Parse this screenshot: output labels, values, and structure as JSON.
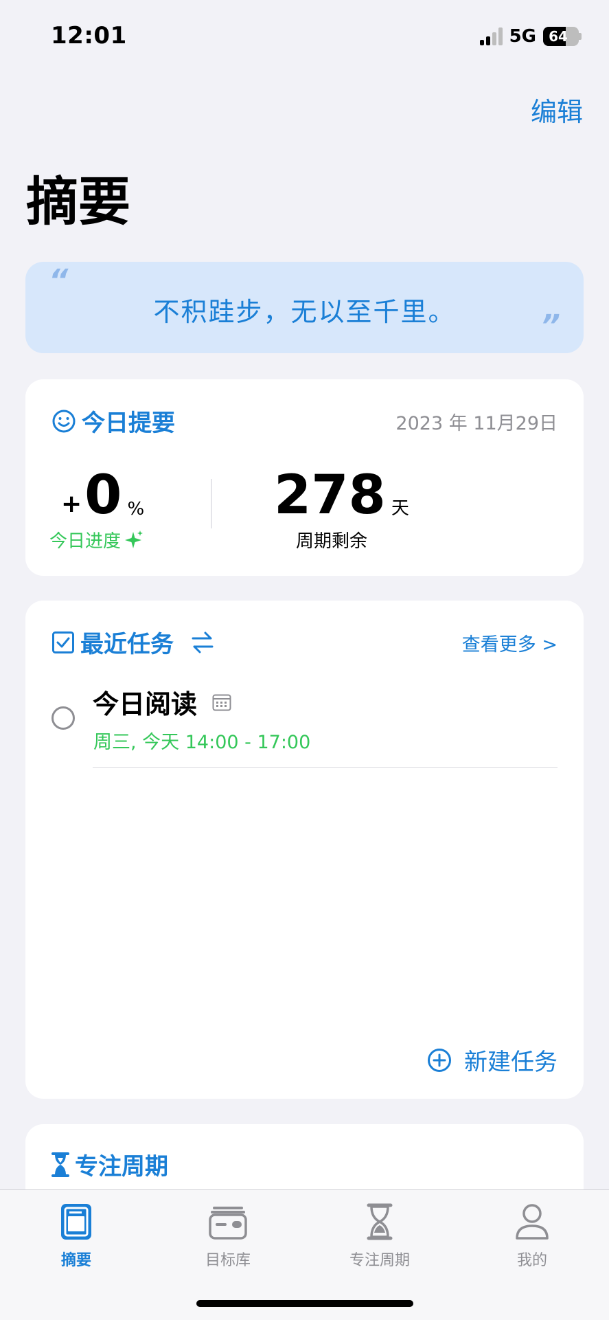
{
  "status_bar": {
    "time": "12:01",
    "network": "5G",
    "battery": "64",
    "battery_level": 0.64
  },
  "header": {
    "edit_label": "编辑",
    "title": "摘要"
  },
  "quote": {
    "open_mark": "“",
    "close_mark": "”",
    "text": "不积跬步，无以至千里。"
  },
  "today_summary": {
    "title": "今日提要",
    "icon": "smile-icon",
    "date": "2023 年 11月29日",
    "progress_sign": "+",
    "progress_value": "0",
    "progress_unit": "%",
    "progress_label": "今日进度",
    "remaining_value": "278",
    "remaining_unit": "天",
    "remaining_label": "周期剩余"
  },
  "recent_tasks": {
    "title": "最近任务",
    "icon": "checkbox-icon",
    "see_more": "查看更多 >",
    "items": [
      {
        "name": "今日阅读",
        "time": "周三, 今天 14:00 - 17:00"
      }
    ],
    "new_task": "新建任务"
  },
  "focus_cycle": {
    "title": "专注周期",
    "icon": "hourglass-icon"
  },
  "tabs": [
    {
      "label": "摘要",
      "icon": "summary-icon",
      "active": true
    },
    {
      "label": "目标库",
      "icon": "wallet-icon",
      "active": false
    },
    {
      "label": "专注周期",
      "icon": "hourglass-icon",
      "active": false
    },
    {
      "label": "我的",
      "icon": "person-icon",
      "active": false
    }
  ],
  "colors": {
    "accent": "#1a7fd6",
    "green": "#34c759",
    "quote_bg": "#d7e7fb",
    "page_bg": "#f2f2f7"
  }
}
